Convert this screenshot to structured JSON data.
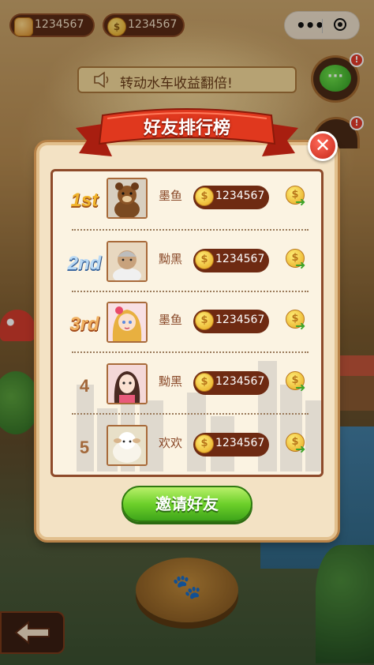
{
  "topbar": {
    "resource_value": "1234567",
    "coin_value": "1234567",
    "coin_symbol": "$"
  },
  "announcement": {
    "text": "转动水车收益翻倍!"
  },
  "chat_badge": "!",
  "second_badge": "!",
  "modal": {
    "title": "好友排行榜",
    "close_glyph": "✕",
    "coin_symbol": "$",
    "invite_label": "邀请好友",
    "rows": [
      {
        "rank": "1st",
        "name": "墨鱼",
        "score": "1234567"
      },
      {
        "rank": "2nd",
        "name": "黝黑",
        "score": "1234567"
      },
      {
        "rank": "3rd",
        "name": "墨鱼",
        "score": "1234567"
      },
      {
        "rank": "4",
        "name": "黝黑",
        "score": "1234567"
      },
      {
        "rank": "5",
        "name": "欢欢",
        "score": "1234567"
      }
    ]
  },
  "colors": {
    "panel_border": "#8e4a2a",
    "score_pill": "#6e2a12",
    "ribbon": "#d8321e",
    "invite_green": "#6dd02a"
  }
}
